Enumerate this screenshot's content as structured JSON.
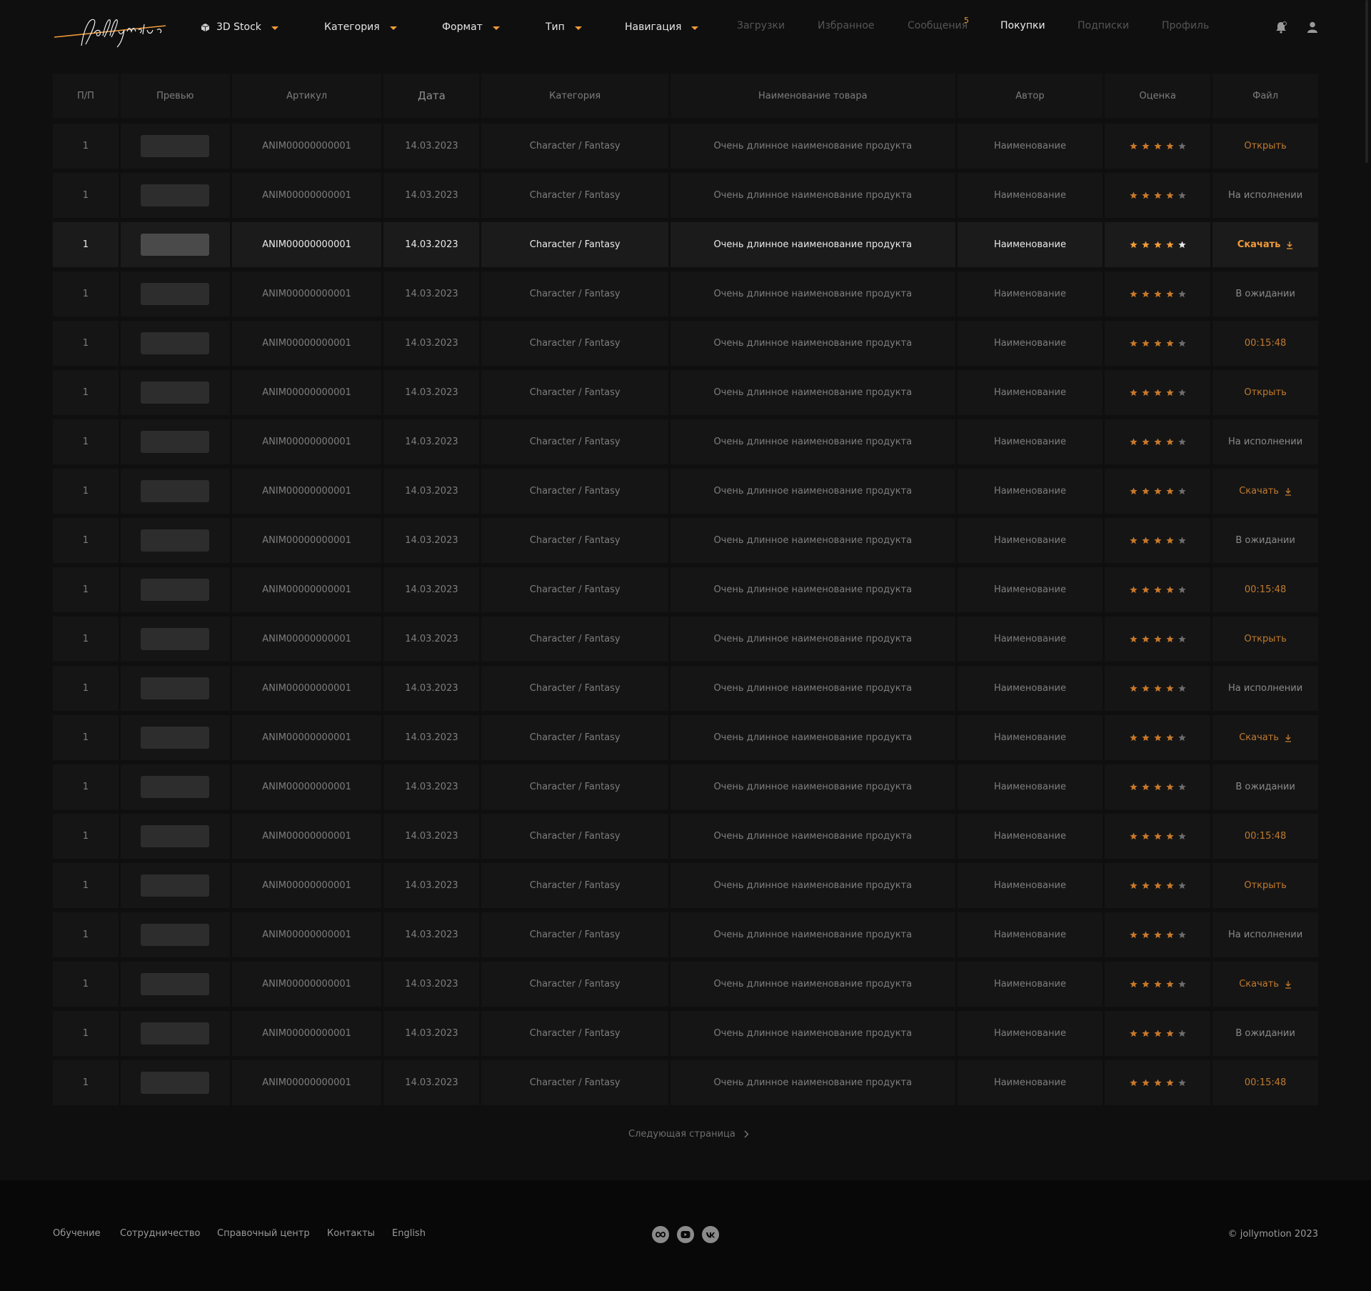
{
  "header": {
    "logo_text": "Jollymotion",
    "dropdowns": [
      {
        "label": "3D Stock",
        "icon": "cube-icon"
      },
      {
        "label": "Категория"
      },
      {
        "label": "Формат"
      },
      {
        "label": "Тип"
      },
      {
        "label": "Навигация"
      }
    ],
    "links": [
      {
        "label": "Загрузки",
        "active": false
      },
      {
        "label": "Избранное",
        "active": false
      },
      {
        "label": "Сообщения",
        "active": false
      },
      {
        "label": "Покупки",
        "active": true
      },
      {
        "label": "Подписки",
        "active": false
      },
      {
        "label": "Профиль",
        "active": false
      }
    ],
    "messages_badge": "5",
    "accent_color": "#f29b38"
  },
  "table": {
    "columns": [
      "П/П",
      "Превью",
      "Артикул",
      "Дата",
      "Категория",
      "Наименование товара",
      "Автор",
      "Оценка",
      "Файл"
    ],
    "rows": [
      {
        "n": "1",
        "sku": "ANIM00000000001",
        "date": "14.03.2023",
        "category": "Character / Fantasy",
        "name": "Очень длинное наименование продукта",
        "author": "Наименование",
        "rating": 4,
        "file": "Открыть",
        "file_type": "orange"
      },
      {
        "n": "1",
        "sku": "ANIM00000000001",
        "date": "14.03.2023",
        "category": "Character / Fantasy",
        "name": "Очень длинное наименование продукта",
        "author": "Наименование",
        "rating": 4,
        "file": "На исполнении",
        "file_type": "grey"
      },
      {
        "n": "1",
        "sku": "ANIM00000000001",
        "date": "14.03.2023",
        "category": "Character / Fantasy",
        "name": "Очень длинное наименование продукта",
        "author": "Наименование",
        "rating": 4,
        "file": "Скачать",
        "file_type": "download",
        "active": true
      },
      {
        "n": "1",
        "sku": "ANIM00000000001",
        "date": "14.03.2023",
        "category": "Character / Fantasy",
        "name": "Очень длинное наименование продукта",
        "author": "Наименование",
        "rating": 4,
        "file": "В ожидании",
        "file_type": "grey"
      },
      {
        "n": "1",
        "sku": "ANIM00000000001",
        "date": "14.03.2023",
        "category": "Character / Fantasy",
        "name": "Очень длинное наименование продукта",
        "author": "Наименование",
        "rating": 4,
        "file": "00:15:48",
        "file_type": "orange"
      },
      {
        "n": "1",
        "sku": "ANIM00000000001",
        "date": "14.03.2023",
        "category": "Character / Fantasy",
        "name": "Очень длинное наименование продукта",
        "author": "Наименование",
        "rating": 4,
        "file": "Открыть",
        "file_type": "orange"
      },
      {
        "n": "1",
        "sku": "ANIM00000000001",
        "date": "14.03.2023",
        "category": "Character / Fantasy",
        "name": "Очень длинное наименование продукта",
        "author": "Наименование",
        "rating": 4,
        "file": "На исполнении",
        "file_type": "grey"
      },
      {
        "n": "1",
        "sku": "ANIM00000000001",
        "date": "14.03.2023",
        "category": "Character / Fantasy",
        "name": "Очень длинное наименование продукта",
        "author": "Наименование",
        "rating": 4,
        "file": "Скачать",
        "file_type": "download"
      },
      {
        "n": "1",
        "sku": "ANIM00000000001",
        "date": "14.03.2023",
        "category": "Character / Fantasy",
        "name": "Очень длинное наименование продукта",
        "author": "Наименование",
        "rating": 4,
        "file": "В ожидании",
        "file_type": "grey"
      },
      {
        "n": "1",
        "sku": "ANIM00000000001",
        "date": "14.03.2023",
        "category": "Character / Fantasy",
        "name": "Очень длинное наименование продукта",
        "author": "Наименование",
        "rating": 4,
        "file": "00:15:48",
        "file_type": "orange"
      },
      {
        "n": "1",
        "sku": "ANIM00000000001",
        "date": "14.03.2023",
        "category": "Character / Fantasy",
        "name": "Очень длинное наименование продукта",
        "author": "Наименование",
        "rating": 4,
        "file": "Открыть",
        "file_type": "orange"
      },
      {
        "n": "1",
        "sku": "ANIM00000000001",
        "date": "14.03.2023",
        "category": "Character / Fantasy",
        "name": "Очень длинное наименование продукта",
        "author": "Наименование",
        "rating": 4,
        "file": "На исполнении",
        "file_type": "grey"
      },
      {
        "n": "1",
        "sku": "ANIM00000000001",
        "date": "14.03.2023",
        "category": "Character / Fantasy",
        "name": "Очень длинное наименование продукта",
        "author": "Наименование",
        "rating": 4,
        "file": "Скачать",
        "file_type": "download"
      },
      {
        "n": "1",
        "sku": "ANIM00000000001",
        "date": "14.03.2023",
        "category": "Character / Fantasy",
        "name": "Очень длинное наименование продукта",
        "author": "Наименование",
        "rating": 4,
        "file": "В ожидании",
        "file_type": "grey"
      },
      {
        "n": "1",
        "sku": "ANIM00000000001",
        "date": "14.03.2023",
        "category": "Character / Fantasy",
        "name": "Очень длинное наименование продукта",
        "author": "Наименование",
        "rating": 4,
        "file": "00:15:48",
        "file_type": "orange"
      },
      {
        "n": "1",
        "sku": "ANIM00000000001",
        "date": "14.03.2023",
        "category": "Character / Fantasy",
        "name": "Очень длинное наименование продукта",
        "author": "Наименование",
        "rating": 4,
        "file": "Открыть",
        "file_type": "orange"
      },
      {
        "n": "1",
        "sku": "ANIM00000000001",
        "date": "14.03.2023",
        "category": "Character / Fantasy",
        "name": "Очень длинное наименование продукта",
        "author": "Наименование",
        "rating": 4,
        "file": "На исполнении",
        "file_type": "grey"
      },
      {
        "n": "1",
        "sku": "ANIM00000000001",
        "date": "14.03.2023",
        "category": "Character / Fantasy",
        "name": "Очень длинное наименование продукта",
        "author": "Наименование",
        "rating": 4,
        "file": "Скачать",
        "file_type": "download"
      },
      {
        "n": "1",
        "sku": "ANIM00000000001",
        "date": "14.03.2023",
        "category": "Character / Fantasy",
        "name": "Очень длинное наименование продукта",
        "author": "Наименование",
        "rating": 4,
        "file": "В ожидании",
        "file_type": "grey"
      },
      {
        "n": "1",
        "sku": "ANIM00000000001",
        "date": "14.03.2023",
        "category": "Character / Fantasy",
        "name": "Очень длинное наименование продукта",
        "author": "Наименование",
        "rating": 4,
        "file": "00:15:48",
        "file_type": "orange"
      }
    ]
  },
  "pagination": {
    "next_label": "Следующая страница"
  },
  "footer": {
    "links": [
      "Обучение",
      "Сотрудничество",
      "Справочный центр",
      "Контакты",
      "English"
    ],
    "social": [
      {
        "icon": "infinity-icon"
      },
      {
        "icon": "youtube-icon"
      },
      {
        "icon": "vk-icon"
      }
    ],
    "copyright": "© jollymotion 2023"
  }
}
